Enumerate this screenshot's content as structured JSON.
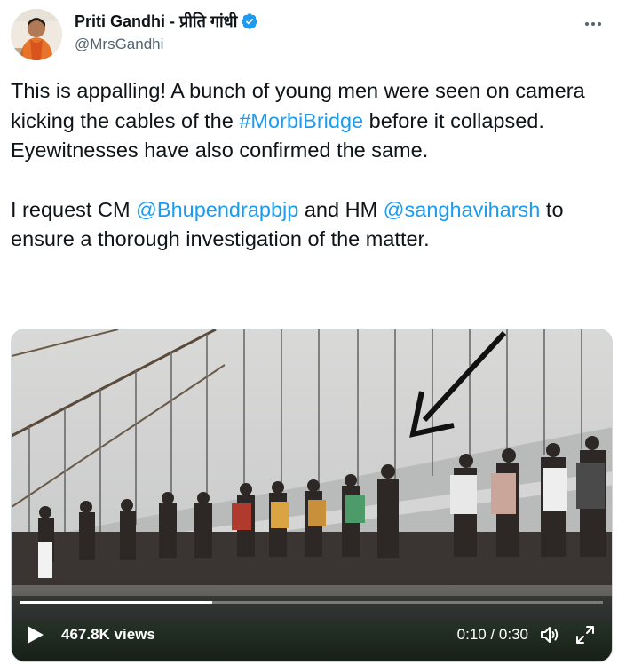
{
  "author": {
    "display_name": "Priti Gandhi - प्रीति गांधी",
    "handle": "@MrsGandhi",
    "verified_icon": "verified-badge-icon"
  },
  "tweet": {
    "p1_a": "This is appalling! A bunch of young men were seen on camera kicking the cables of the ",
    "p1_hashtag": "#MorbiBridge",
    "p1_b": " before it collapsed. Eyewitnesses have also confirmed the same.",
    "p2_a": "I request CM ",
    "p2_mention1": "@Bhupendrapbjp",
    "p2_b": " and HM ",
    "p2_mention2": "@sanghaviharsh",
    "p2_c": " to ensure a thorough investigation of the matter."
  },
  "video": {
    "views": "467.8K views",
    "time": "0:10 / 0:30",
    "progress": 0.33
  },
  "colors": {
    "link": "#1d9bf0",
    "verified": "#1d9bf0",
    "text": "#0f1419",
    "secondary": "#536471"
  }
}
